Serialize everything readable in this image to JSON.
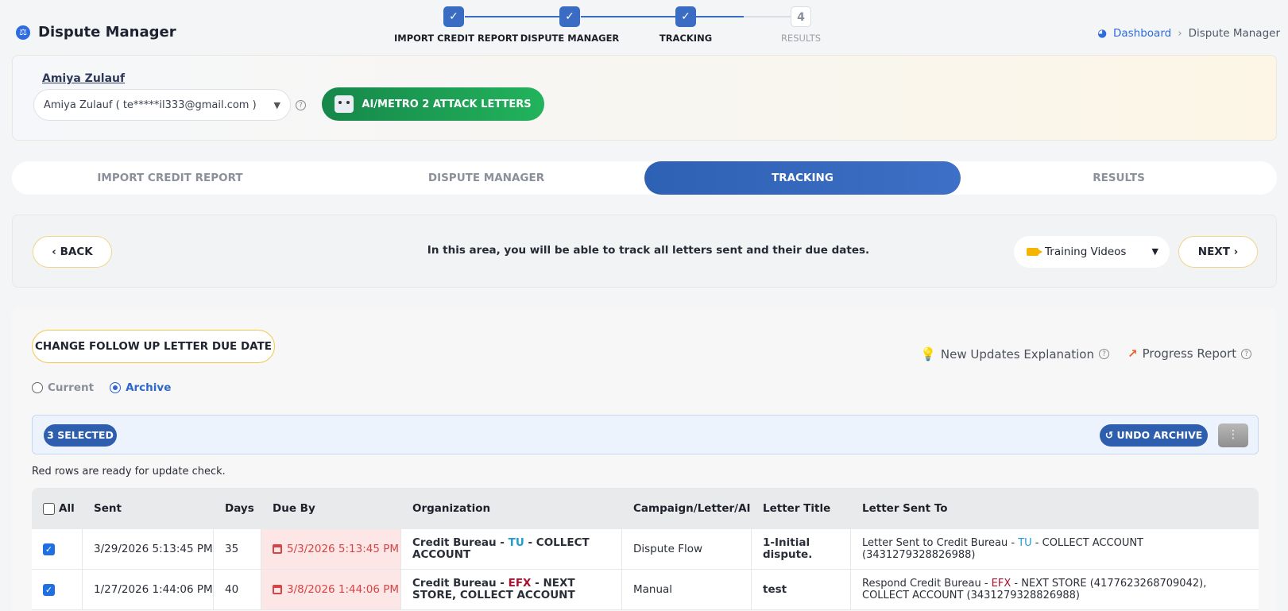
{
  "header": {
    "app_title": "Dispute Manager",
    "steps": [
      {
        "label": "IMPORT CREDIT REPORT",
        "state": "done",
        "glyph": "✓"
      },
      {
        "label": "DISPUTE MANAGER",
        "state": "done",
        "glyph": "✓"
      },
      {
        "label": "TRACKING",
        "state": "done",
        "glyph": "✓"
      },
      {
        "label": "RESULTS",
        "state": "pending",
        "glyph": "4"
      }
    ],
    "breadcrumb": {
      "home": "Dashboard",
      "current": "Dispute Manager"
    }
  },
  "client": {
    "name": "Amiya Zulauf",
    "select_value": "Amiya Zulauf ( te*****il333@gmail.com )",
    "ai_button": "AI/METRO 2 ATTACK LETTERS"
  },
  "tabs": [
    {
      "label": "IMPORT CREDIT REPORT",
      "active": false
    },
    {
      "label": "DISPUTE MANAGER",
      "active": false
    },
    {
      "label": "TRACKING",
      "active": true
    },
    {
      "label": "RESULTS",
      "active": false
    }
  ],
  "info_bar": {
    "back": "BACK",
    "text": "In this area, you will be able to track all letters sent and their due dates.",
    "video_select": "Training Videos",
    "next": "NEXT"
  },
  "tracking": {
    "followup_button": "CHANGE FOLLOW UP LETTER DUE DATE",
    "updates_link": "New Updates Explanation",
    "progress_link": "Progress Report",
    "radio_current": "Current",
    "radio_archive": "Archive",
    "selected_badge": "3 SELECTED",
    "undo_archive": "UNDO ARCHIVE",
    "red_note": "Red rows are ready for update check.",
    "columns": [
      "All",
      "Sent",
      "Days",
      "Due By",
      "Organization",
      "Campaign/Letter/AI",
      "Letter Title",
      "Letter Sent To"
    ],
    "rows": [
      {
        "checked": true,
        "sent": "3/29/2026 5:13:45 PM",
        "days": "35",
        "due": "5/3/2026 5:13:45 PM",
        "org_prefix": "Credit Bureau - ",
        "org_bureau": "TU",
        "org_suffix": " - COLLECT ACCOUNT",
        "campaign": "Dispute Flow",
        "title": "1-Initial dispute.",
        "sent_to_prefix": "Letter Sent to Credit Bureau - ",
        "sent_to_bureau": "TU",
        "sent_to_suffix": " - COLLECT ACCOUNT (3431279328826988)"
      },
      {
        "checked": true,
        "sent": "1/27/2026 1:44:06 PM",
        "days": "40",
        "due": "3/8/2026 1:44:06 PM",
        "org_prefix": "Credit Bureau - ",
        "org_bureau": "EFX",
        "org_suffix": " - NEXT STORE, COLLECT ACCOUNT",
        "campaign": "Manual",
        "title": "test",
        "sent_to_prefix": "Respond Credit Bureau - ",
        "sent_to_bureau": "EFX",
        "sent_to_suffix": " - NEXT STORE (4177623268709042), COLLECT ACCOUNT (3431279328826988)"
      }
    ]
  },
  "colors": {
    "accent": "#2e5faf",
    "green": "#1fa257",
    "due_red": "#d64545",
    "tu": "#1e9fcf",
    "efx": "#a8102b"
  }
}
